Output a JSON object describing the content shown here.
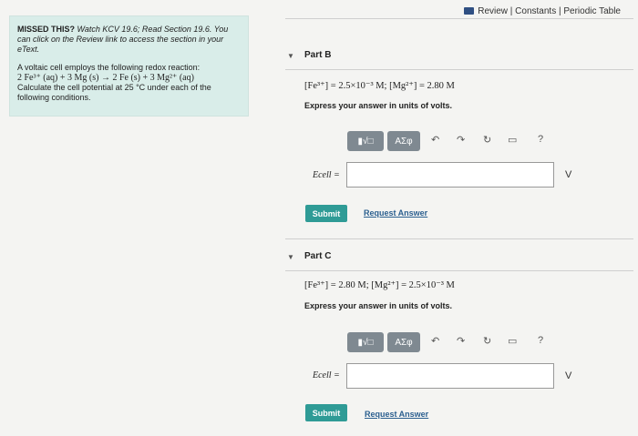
{
  "header": {
    "links": "Review | Constants | Periodic Table"
  },
  "intro": {
    "title_bold": "MISSED THIS?",
    "title_rest": " Watch KCV 19.6; Read Section 19.6. You can click on the Review link to access the section in your eText.",
    "line1": "A voltaic cell employs the following redox reaction:",
    "equation": "2 Fe³⁺ (aq) + 3 Mg (s) → 2 Fe (s) + 3 Mg²⁺ (aq)",
    "line3": "Calculate the cell potential at 25 °C under each of the following conditions."
  },
  "partB": {
    "label": "Part B",
    "conditions": "[Fe³⁺] = 2.5×10⁻³ M; [Mg²⁺] = 2.80 M",
    "instruction": "Express your answer in units of volts.",
    "toolbar_symbol": "AΣφ",
    "help": "?",
    "label_e": "Ecell =",
    "unit": "V",
    "submit": "Submit",
    "request": "Request Answer"
  },
  "partC": {
    "label": "Part C",
    "conditions": "[Fe³⁺] = 2.80 M; [Mg²⁺] = 2.5×10⁻³ M",
    "instruction": "Express your answer in units of volts.",
    "toolbar_symbol": "AΣφ",
    "help": "?",
    "label_e": "Ecell =",
    "unit": "V",
    "submit": "Submit",
    "request": "Request Answer"
  }
}
